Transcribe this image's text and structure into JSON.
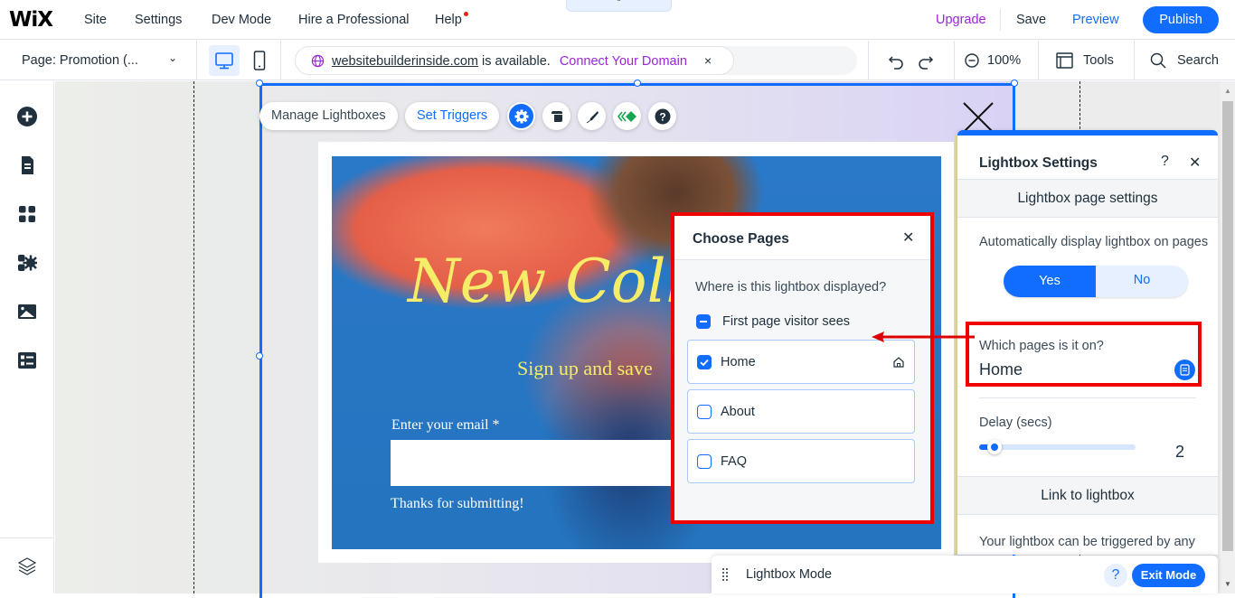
{
  "topbar": {
    "logo": "WiX",
    "menu": [
      "Site",
      "Settings",
      "Dev Mode",
      "Hire a Professional",
      "Help"
    ],
    "upgrade": "Upgrade",
    "save": "Save",
    "preview": "Preview",
    "publish": "Publish",
    "collapse_icon": "chevron-up-icon"
  },
  "toolbar": {
    "page_select": "Page: Promotion (...",
    "domain_name": "websitebuilderinside.com",
    "domain_available": "is available.",
    "connect_domain": "Connect Your Domain",
    "zoom_level": "100%",
    "tools": "Tools",
    "search": "Search"
  },
  "leftbar": {
    "icons": [
      "add-icon",
      "pages-icon",
      "apps-icon",
      "business-apps-icon",
      "media-icon",
      "cms-icon",
      "layers-icon"
    ]
  },
  "lightbox_toolbar": {
    "manage": "Manage Lightboxes",
    "triggers": "Set Triggers",
    "icons": [
      "settings-icon",
      "layout-icon",
      "design-icon",
      "animation-icon",
      "help-icon"
    ]
  },
  "lightbox_content": {
    "title": "New Coll",
    "subtitle": "Sign up and save",
    "email_label": "Enter your email *",
    "email_value": "",
    "success": "Thanks for submitting!"
  },
  "choose_pages": {
    "title": "Choose Pages",
    "question": "Where is this lightbox displayed?",
    "first_page": {
      "label": "First page visitor sees",
      "state": "indeterminate"
    },
    "pages": [
      {
        "label": "Home",
        "checked": true,
        "is_home": true
      },
      {
        "label": "About",
        "checked": false,
        "is_home": false
      },
      {
        "label": "FAQ",
        "checked": false,
        "is_home": false
      }
    ]
  },
  "settings_panel": {
    "title": "Lightbox Settings",
    "help": "?",
    "section1": "Lightbox page settings",
    "auto_display_label": "Automatically display lightbox on pages",
    "yes": "Yes",
    "no": "No",
    "auto_display_value": "Yes",
    "pages_label": "Which pages is it on?",
    "pages_value": "Home",
    "delay_label": "Delay (secs)",
    "delay_value": "2",
    "delay_fraction": 0.05,
    "section2": "Link to lightbox",
    "link_desc": "Your lightbox can be triggered by any button or link on your website."
  },
  "mode_bar": {
    "label": "Lightbox Mode",
    "help": "?",
    "exit": "Exit Mode"
  },
  "colors": {
    "accent": "#116dff",
    "upgrade": "#9a27d5",
    "highlight": "#ee0000",
    "hero_text": "#f5ed68"
  }
}
